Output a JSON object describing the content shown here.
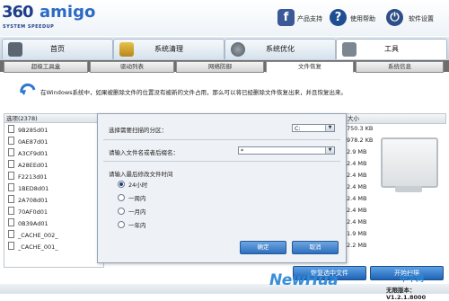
{
  "header": {
    "logo_number": "360",
    "logo_word": "amigo",
    "logo_subtitle": "SYSTEM SPEEDUP",
    "links": [
      {
        "label": "产品支持",
        "icon": "facebook-icon"
      },
      {
        "label": "使用帮助",
        "icon": "help-icon"
      },
      {
        "label": "软件设置",
        "icon": "settings-icon"
      }
    ]
  },
  "main_tabs": [
    {
      "label": "首页",
      "icon": "home-icon"
    },
    {
      "label": "系统清理",
      "icon": "broom-icon"
    },
    {
      "label": "系统优化",
      "icon": "gear-icon"
    },
    {
      "label": "工具",
      "icon": "tools-icon",
      "active": true
    }
  ],
  "sub_tabs": [
    {
      "label": "超级工具盒"
    },
    {
      "label": "驱动列表"
    },
    {
      "label": "网络防御"
    },
    {
      "label": "文件恢复",
      "active": true
    },
    {
      "label": "系统信息"
    }
  ],
  "info_text": "在Windows系统中，如果被删除文件的位置没有被新的文件占用，那么可以将已经删除文件恢复出来，并且恢复出来。",
  "file_list": {
    "header": "选项(2378)",
    "items": [
      "9B285d01",
      "0AE87d01",
      "A3CF9d01",
      "A28EEd01",
      "F2213d01",
      "1BED8d01",
      "2A708d01",
      "70AF0d01",
      "0B39Ad01",
      "_CACHE_002_",
      "_CACHE_001_"
    ]
  },
  "size_column": {
    "header": "大小",
    "values": [
      "750.3 KB",
      "978.2 KB",
      "2.9 MB",
      "2.4 MB",
      "2.4 MB",
      "2.4 MB",
      "2.4 MB",
      "2.4 MB",
      "2.4 MB",
      "1.9 MB",
      "2.2 MB"
    ]
  },
  "dialog": {
    "partition_label": "选择需要扫描的分区：",
    "partition_value": "C:",
    "filename_label": "请输入文件名或者后缀名：",
    "filename_value": "*",
    "time_label": "请输入最后修改文件时间",
    "options": [
      "24小时",
      "一周内",
      "一月内",
      "一年内"
    ],
    "selected_option": 0,
    "ok_label": "确定",
    "cancel_label": "取消"
  },
  "bottom_buttons": {
    "recover_label": "恢复选中文件",
    "scan_label": "开始扫描"
  },
  "version": "无限版本：V1.2.1.8000",
  "watermark": "NewHua",
  "watermark_sub": "中华网",
  "colors": {
    "accent": "#2d6fbf",
    "header_blue": "#1f3e8a"
  }
}
